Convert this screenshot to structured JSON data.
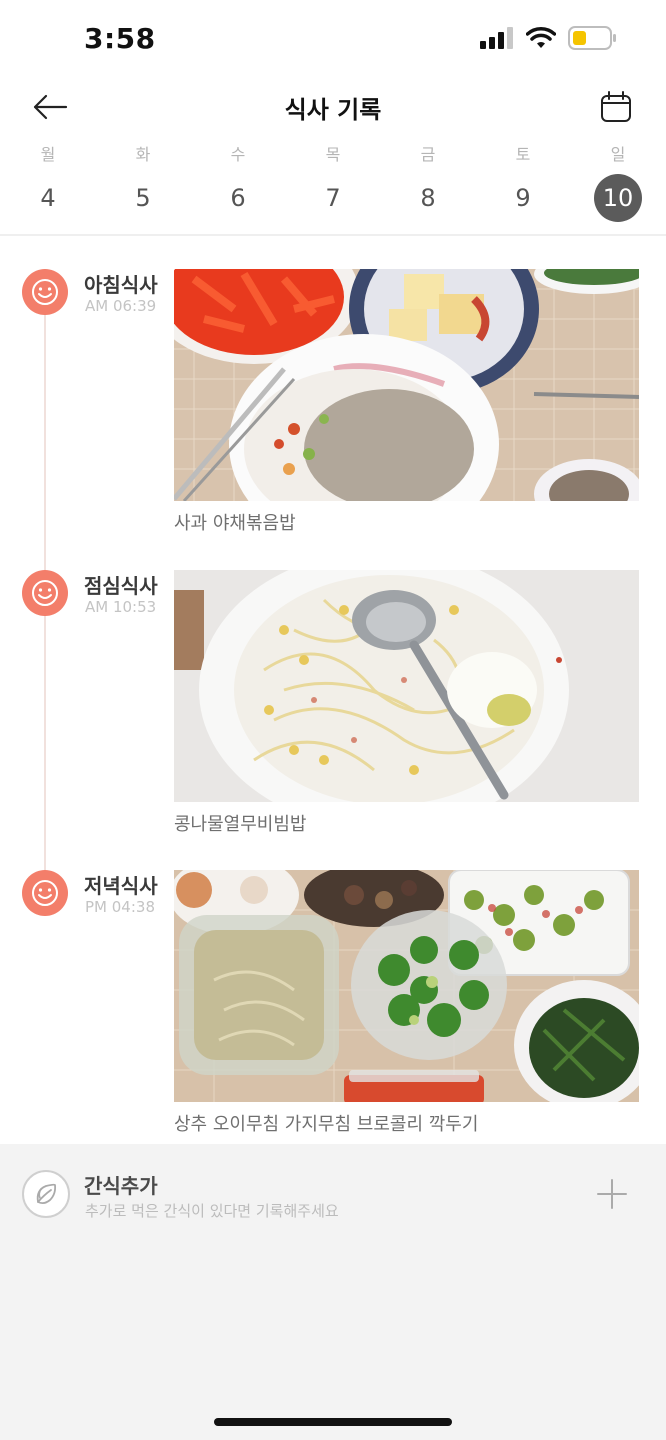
{
  "status_bar": {
    "time": "3:58",
    "battery_color": "#f5c400"
  },
  "nav": {
    "title": "식사 기록",
    "back_icon": "arrow-left-icon",
    "calendar_icon": "calendar-icon"
  },
  "week": {
    "days": [
      {
        "name": "월",
        "num": "4"
      },
      {
        "name": "화",
        "num": "5"
      },
      {
        "name": "수",
        "num": "6"
      },
      {
        "name": "목",
        "num": "7"
      },
      {
        "name": "금",
        "num": "8"
      },
      {
        "name": "토",
        "num": "9"
      },
      {
        "name": "일",
        "num": "10",
        "selected": true
      }
    ]
  },
  "meals": [
    {
      "title": "아침식사",
      "time": "AM 06:39",
      "description": "사과 야채볶음밥",
      "icon": "smile-icon"
    },
    {
      "title": "점심식사",
      "time": "AM 10:53",
      "description": "콩나물열무비빔밥",
      "icon": "smile-icon"
    },
    {
      "title": "저녁식사",
      "time": "PM 04:38",
      "description": "상추 오이무침 가지무침 브로콜리 깍두기",
      "icon": "smile-icon"
    }
  ],
  "snack": {
    "title": "간식추가",
    "subtitle": "추가로 먹은 간식이 있다면 기록해주세요",
    "icon": "leaf-icon",
    "add_icon": "plus-icon"
  },
  "colors": {
    "accent": "#f37e6a",
    "selected_day": "#5b5b5b",
    "snack_bg": "#f3f3f3"
  }
}
